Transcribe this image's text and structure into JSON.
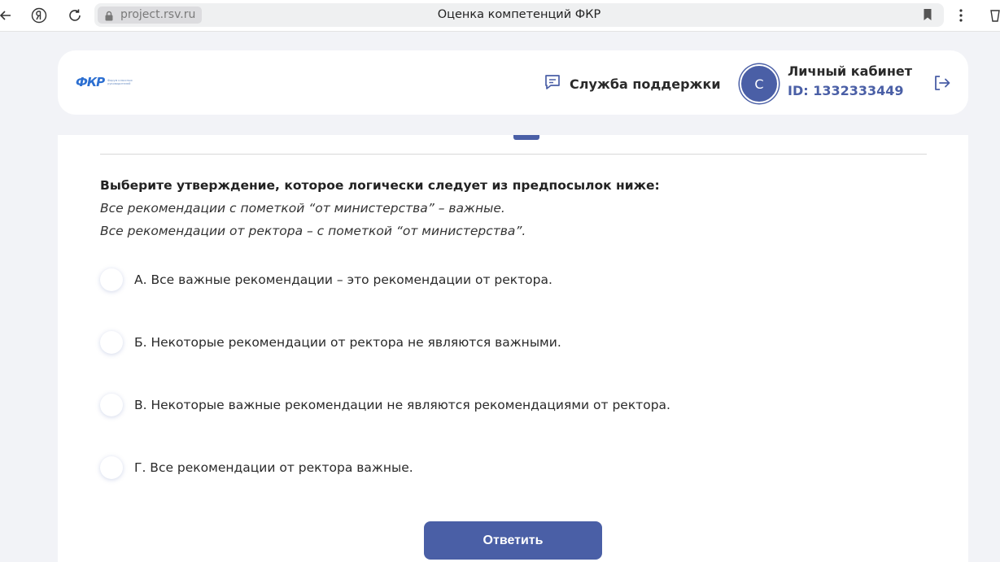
{
  "browser": {
    "url": "project.rsv.ru",
    "tab_title": "Оценка компетенций ФКР"
  },
  "header": {
    "logo_mark": "ФКР",
    "logo_text": "Форум классных руководителей",
    "support_label": "Служба поддержки",
    "avatar_letter": "С",
    "cabinet_title": "Личный кабинет",
    "cabinet_id": "ID: 1332333449"
  },
  "question": {
    "title": "Выберите утверждение, которое логически следует из предпосылок ниже:",
    "premise_1": "Все рекомендации с пометкой “от министерства” – важные.",
    "premise_2": "Все рекомендации от ректора – с пометкой “от министерства”.",
    "options": [
      {
        "label": "А. Все важные рекомендации – это рекомендации от ректора."
      },
      {
        "label": "Б. Некоторые рекомендации от ректора не являются важными."
      },
      {
        "label": "В. Некоторые важные рекомендации не являются рекомендациями от ректора."
      },
      {
        "label": "Г. Все рекомендации от ректора важные."
      }
    ],
    "submit_label": "Ответить"
  },
  "colors": {
    "accent": "#4a5fa6",
    "background": "#f2f3f7"
  }
}
